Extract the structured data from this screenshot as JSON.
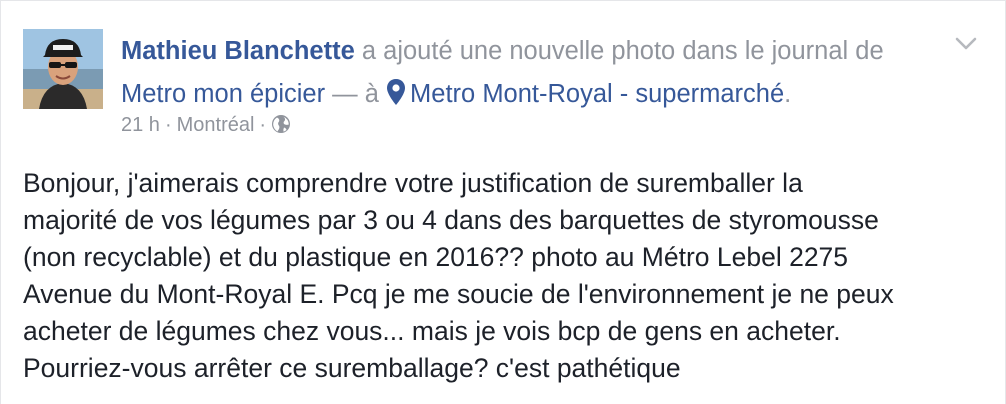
{
  "post": {
    "author": "Mathieu Blanchette",
    "action_text": "a ajouté une nouvelle photo dans le journal de",
    "page_name": "Metro mon épicier",
    "at_text": "— à",
    "location": "Metro Mont-Royal - supermarché",
    "location_end": ".",
    "time": "21 h",
    "city": "Montréal",
    "separator": "·",
    "privacy_icon": "globe-icon",
    "location_icon": "map-pin-icon",
    "menu_icon": "chevron-down-icon",
    "message": "Bonjour, j'aimerais comprendre votre justification de suremballer la\nmajorité de vos légumes par 3 ou 4 dans des barquettes de styromousse\n(non recyclable) et du plastique en 2016?? photo au Métro Lebel 2275\nAvenue du Mont-Royal E. Pcq je me soucie de l'environnement je ne peux\nacheter de légumes chez vous... mais je vois bcp de gens en acheter.\nPourriez-vous arrêter ce suremballage? c'est pathétique"
  },
  "colors": {
    "link": "#365899",
    "secondary_text": "#90949c",
    "body_text": "#1d2129",
    "background": "#ffffff"
  }
}
